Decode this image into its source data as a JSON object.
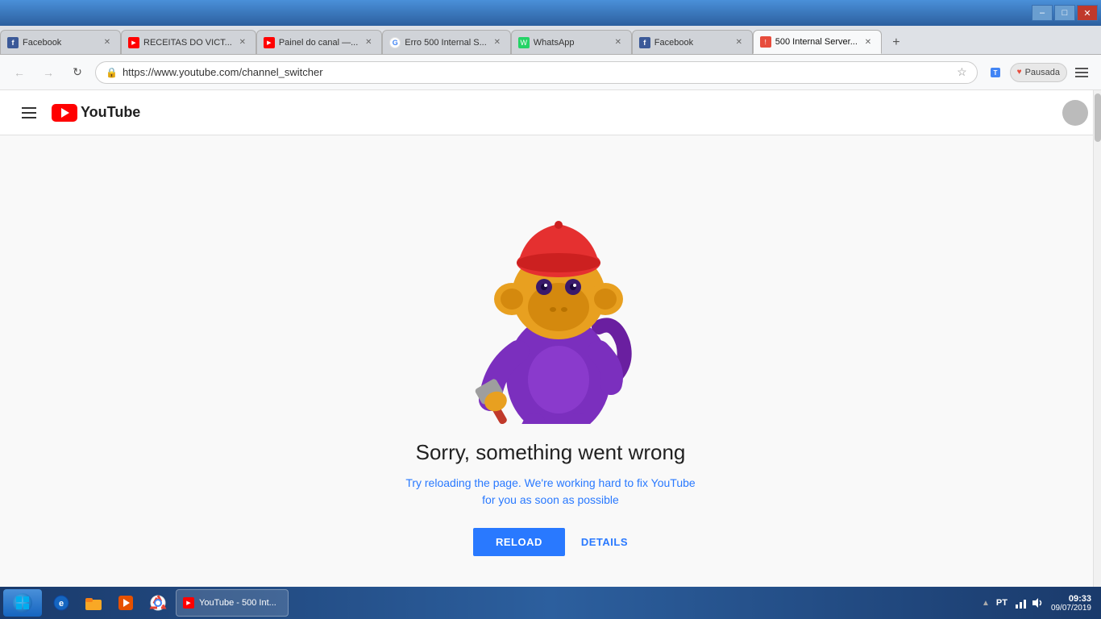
{
  "titlebar": {
    "minimize_label": "–",
    "maximize_label": "□",
    "close_label": "✕"
  },
  "tabs": [
    {
      "id": "tab1",
      "label": "Facebook",
      "favicon": "fb",
      "active": false
    },
    {
      "id": "tab2",
      "label": "RECEITAS DO VICT...",
      "favicon": "yt",
      "active": false
    },
    {
      "id": "tab3",
      "label": "Painel do canal —...",
      "favicon": "yt",
      "active": false
    },
    {
      "id": "tab4",
      "label": "Erro 500 Internal S...",
      "favicon": "g",
      "active": false
    },
    {
      "id": "tab5",
      "label": "WhatsApp",
      "favicon": "wa",
      "active": false
    },
    {
      "id": "tab6",
      "label": "Facebook",
      "favicon": "fb",
      "active": false
    },
    {
      "id": "tab7",
      "label": "500 Internal Server...",
      "favicon": "500",
      "active": true
    }
  ],
  "addressbar": {
    "url": "https://www.youtube.com/channel_switcher",
    "back_title": "Voltar",
    "forward_title": "Avançar",
    "reload_title": "Recarregar página"
  },
  "youtube": {
    "logo_text": "YouTube",
    "header_title": "YouTube"
  },
  "error_page": {
    "title": "Sorry, something went wrong",
    "subtitle_line1": "Try reloading the page. We're working hard to fix YouTube",
    "subtitle_line2": "for you as soon as possible",
    "reload_button": "RELOAD",
    "details_button": "DETAILS"
  },
  "taskbar": {
    "language": "PT",
    "time": "09:33",
    "date": "09/07/2019",
    "app_label": "YouTube - 500 Int...",
    "app_favicon": "yt"
  },
  "icons": {
    "hamburger": "≡",
    "star": "☆",
    "back": "←",
    "forward": "→",
    "reload": "↻",
    "lock": "🔒",
    "menu_dots": "⋮",
    "chevron_up": "▲",
    "chevron_down": "▼",
    "speaker": "🔊",
    "network": "📶",
    "battery": "🔋"
  }
}
